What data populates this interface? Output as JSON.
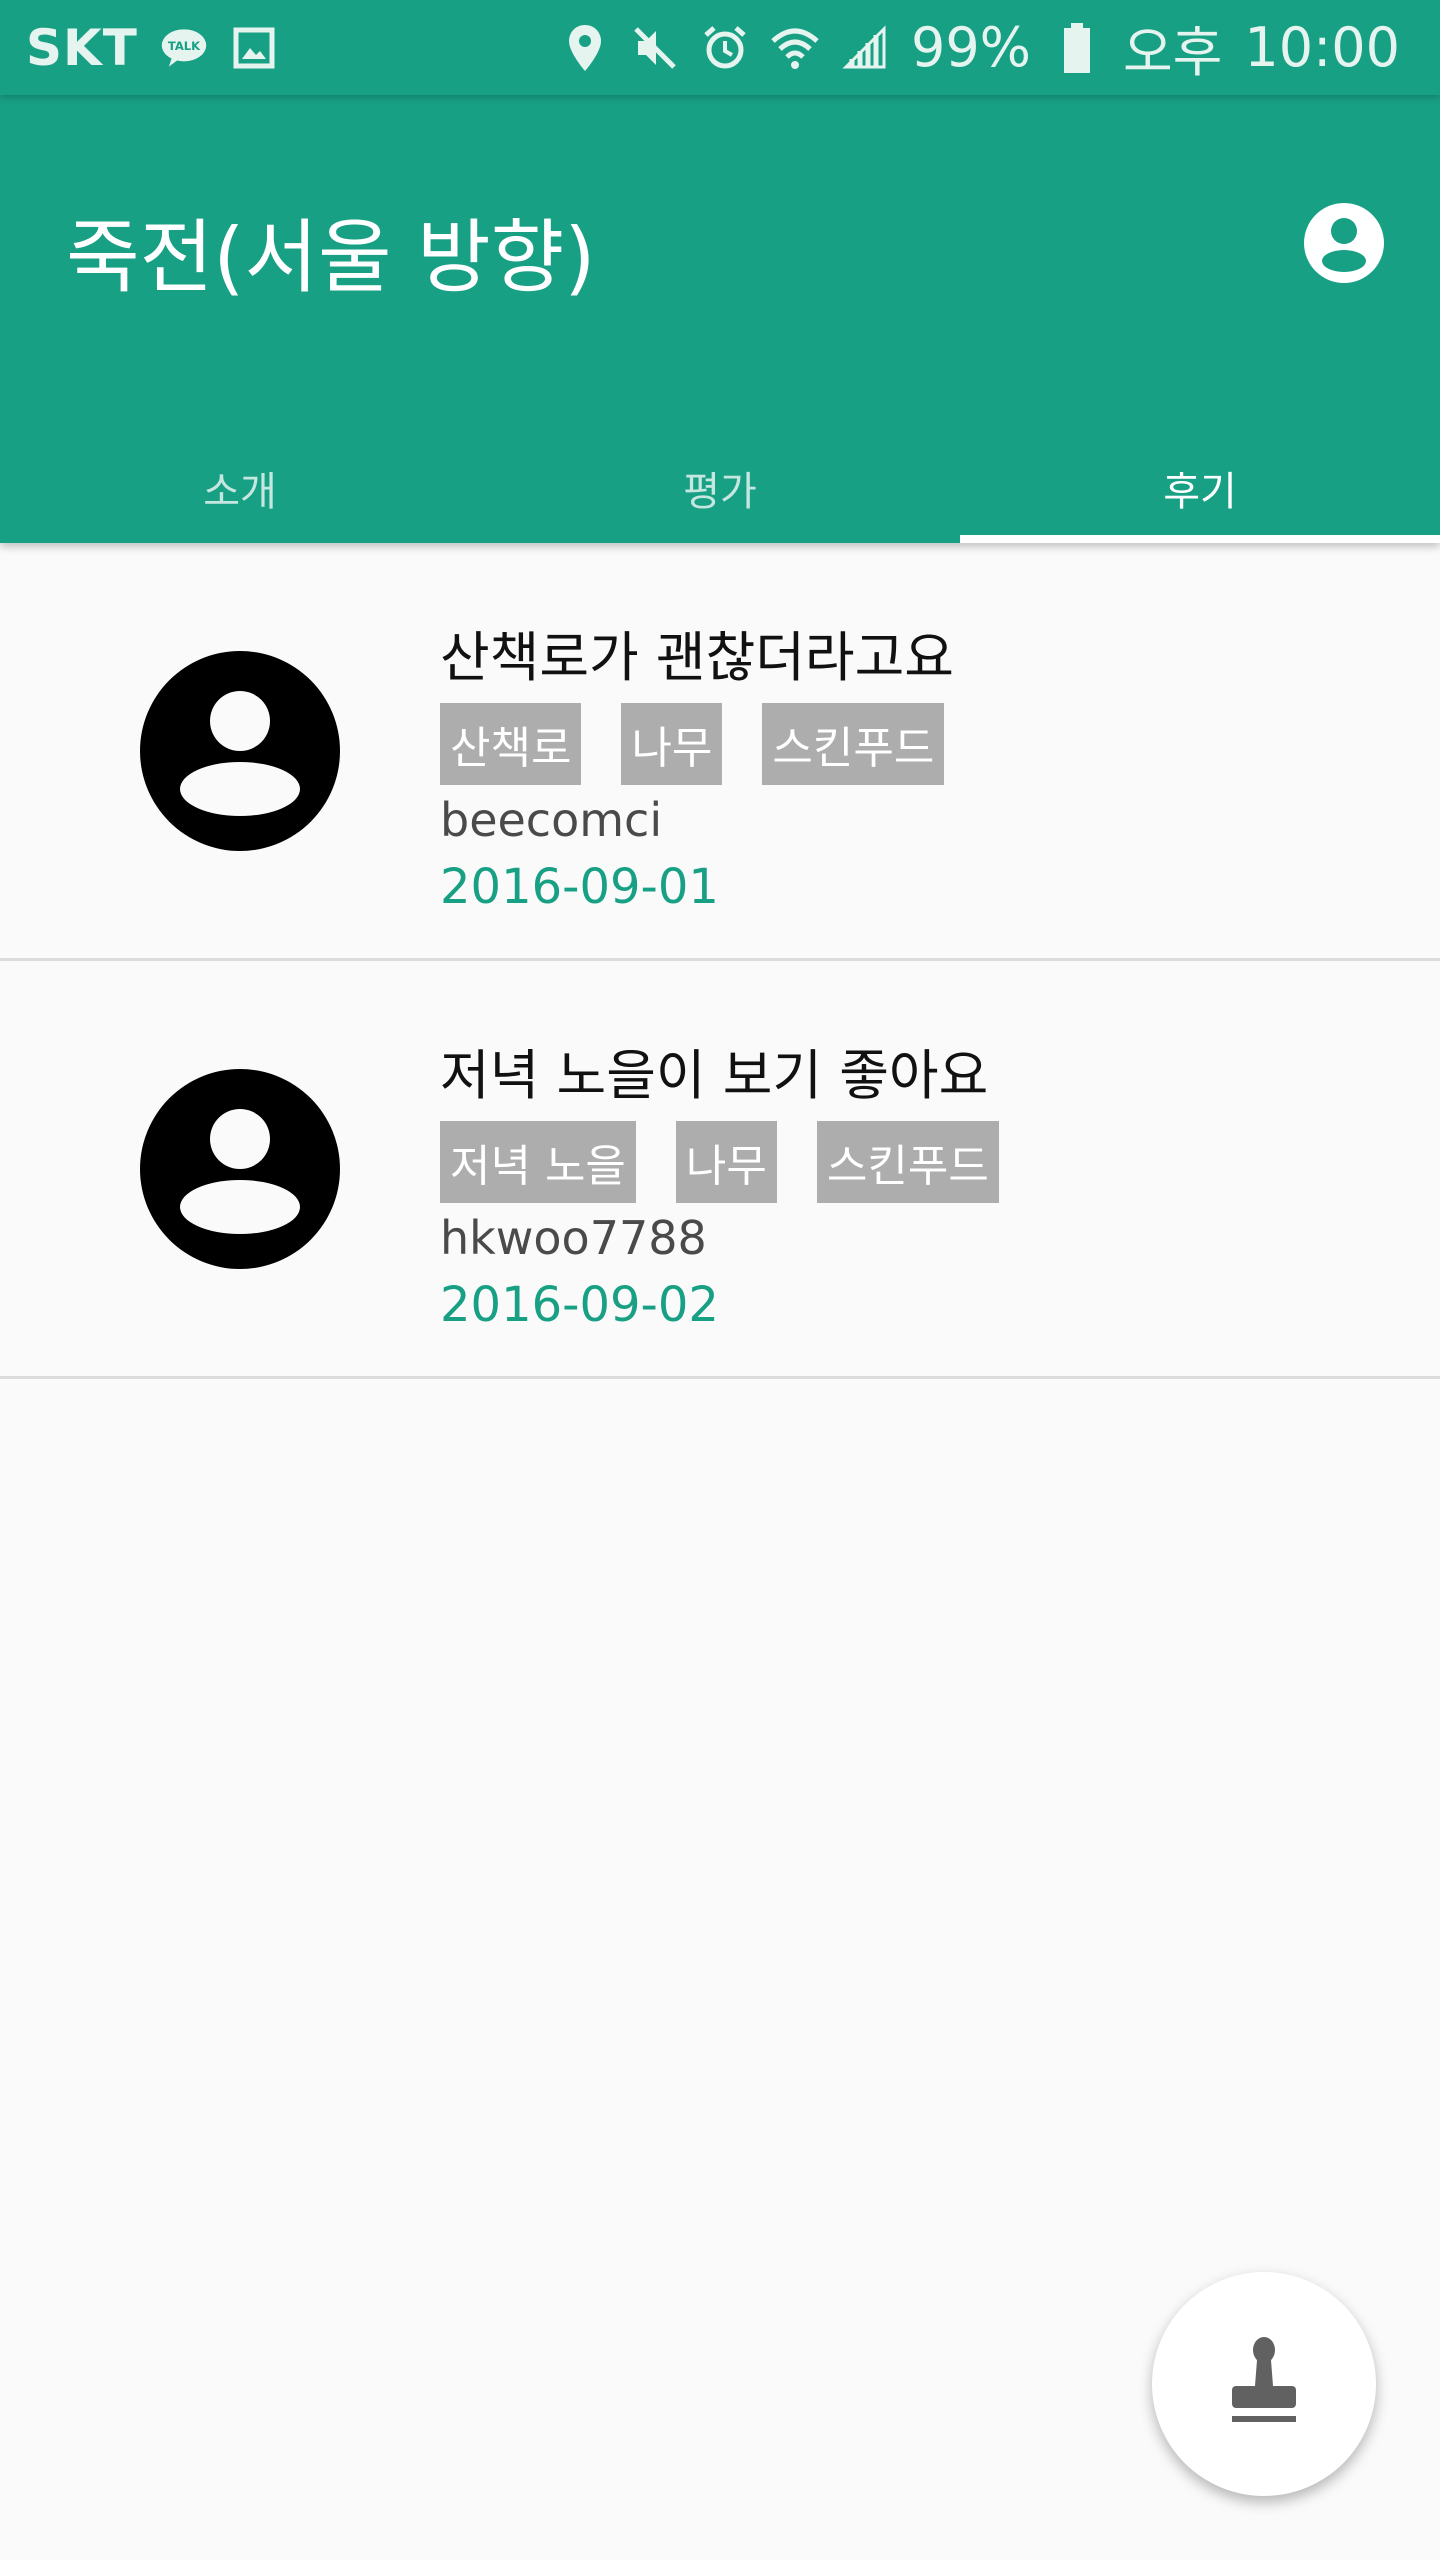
{
  "status_bar": {
    "carrier": "SKT",
    "left_icons": [
      "kakaotalk-icon",
      "image-icon"
    ],
    "right_icons": [
      "location-icon",
      "mute-icon",
      "alarm-icon",
      "wifi-icon",
      "signal-icon",
      "battery-icon"
    ],
    "battery": "99%",
    "ampm": "오후",
    "time": "10:00",
    "talk_badge": "TALK"
  },
  "app_bar": {
    "title": "죽전(서울 방향)",
    "account_icon": "account-circle-icon",
    "background_color": "#18a085"
  },
  "tabs": [
    {
      "label": "소개",
      "active": false
    },
    {
      "label": "평가",
      "active": false
    },
    {
      "label": "후기",
      "active": true
    }
  ],
  "reviews": [
    {
      "title": "산책로가 괜찮더라고요",
      "tags": [
        "산책로",
        "나무",
        "스킨푸드"
      ],
      "author": "beecomci",
      "date": "2016-09-01"
    },
    {
      "title": "저녁 노을이 보기 좋아요",
      "tags": [
        "저녁 노을",
        "나무",
        "스킨푸드"
      ],
      "author": "hkwoo7788",
      "date": "2016-09-02"
    }
  ],
  "fab": {
    "icon": "stamp-icon"
  },
  "colors": {
    "accent": "#18a085",
    "tag_background": "#adadad",
    "date_text": "#18a085"
  }
}
